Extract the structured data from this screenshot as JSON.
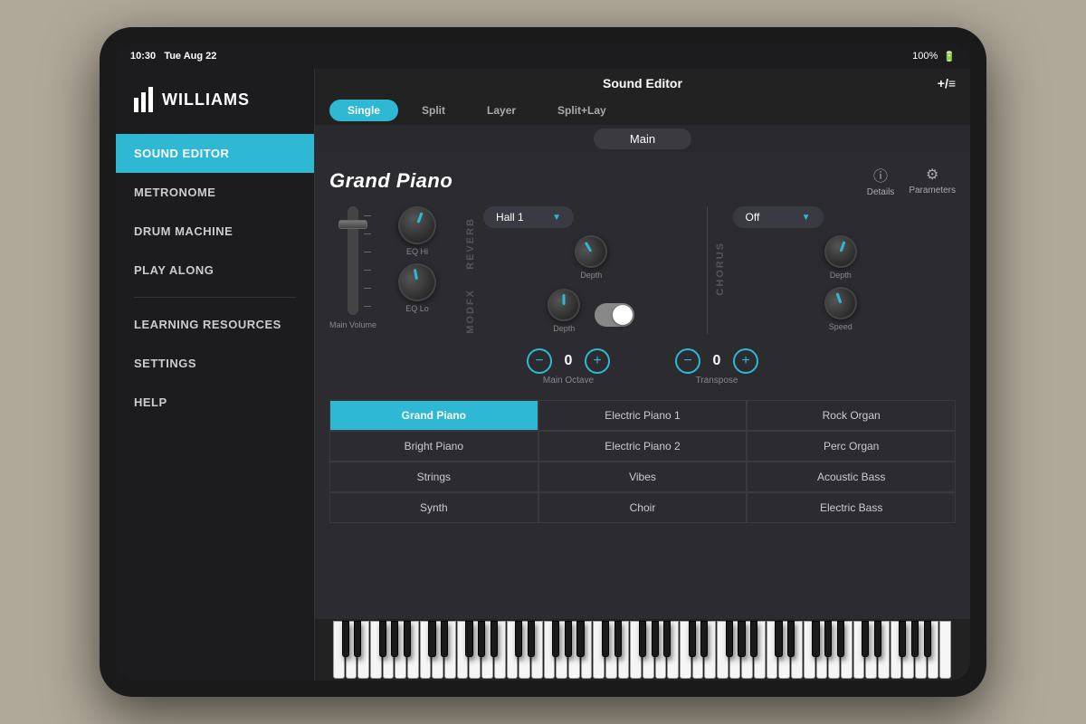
{
  "status": {
    "time": "10:30",
    "date": "Tue Aug 22",
    "battery": "100%"
  },
  "app": {
    "title": "Sound Editor",
    "expand_icon": "+/≡"
  },
  "sidebar": {
    "logo_text": "WILLIAMS",
    "items": [
      {
        "id": "sound-editor",
        "label": "Sound Editor",
        "active": true
      },
      {
        "id": "metronome",
        "label": "Metronome",
        "active": false
      },
      {
        "id": "drum-machine",
        "label": "Drum Machine",
        "active": false
      },
      {
        "id": "play-along",
        "label": "Play Along",
        "active": false
      },
      {
        "id": "learning-resources",
        "label": "Learning Resources",
        "active": false
      },
      {
        "id": "settings",
        "label": "Settings",
        "active": false
      },
      {
        "id": "help",
        "label": "Help",
        "active": false
      }
    ]
  },
  "tabs": [
    {
      "id": "single",
      "label": "Single",
      "active": true
    },
    {
      "id": "split",
      "label": "Split",
      "active": false
    },
    {
      "id": "layer",
      "label": "Layer",
      "active": false
    },
    {
      "id": "splitlay",
      "label": "Split+Lay",
      "active": false
    }
  ],
  "sub_tabs": [
    {
      "id": "main",
      "label": "Main",
      "active": true
    }
  ],
  "instrument": {
    "name": "Grand Piano",
    "details_label": "Details",
    "parameters_label": "Parameters"
  },
  "reverb": {
    "label": "Reverb",
    "preset": "Hall 1",
    "depth_label": "Depth"
  },
  "chorus": {
    "label": "Chorus",
    "preset": "Off",
    "depth_label": "Depth",
    "speed_label": "Speed"
  },
  "modfx": {
    "label": "ModFX",
    "depth_label": "Depth",
    "toggle_on": false
  },
  "eq": {
    "hi_label": "EQ Hi",
    "lo_label": "EQ Lo"
  },
  "volume": {
    "label": "Main Volume"
  },
  "octave": {
    "label": "Main Octave",
    "value": "0",
    "minus": "−",
    "plus": "+"
  },
  "transpose": {
    "label": "Transpose",
    "value": "0",
    "minus": "−",
    "plus": "+"
  },
  "sounds": {
    "col1": [
      {
        "label": "Grand Piano",
        "active": true
      },
      {
        "label": "Bright Piano",
        "active": false
      },
      {
        "label": "Strings",
        "active": false
      },
      {
        "label": "Synth",
        "active": false
      }
    ],
    "col2": [
      {
        "label": "Electric Piano 1",
        "active": false
      },
      {
        "label": "Electric Piano 2",
        "active": false
      },
      {
        "label": "Vibes",
        "active": false
      },
      {
        "label": "Choir",
        "active": false
      }
    ],
    "col3": [
      {
        "label": "Rock Organ",
        "active": false
      },
      {
        "label": "Perc Organ",
        "active": false
      },
      {
        "label": "Acoustic Bass",
        "active": false
      },
      {
        "label": "Electric Bass",
        "active": false
      }
    ]
  }
}
